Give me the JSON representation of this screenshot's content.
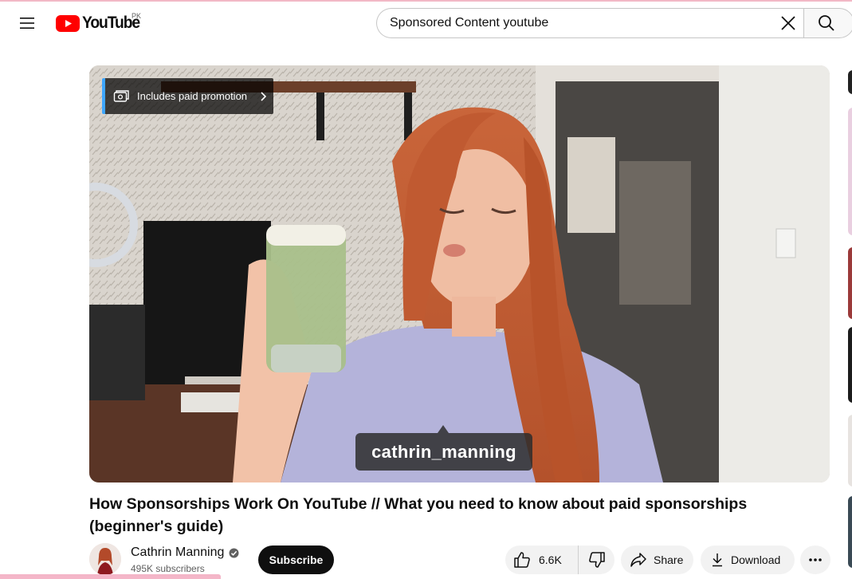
{
  "header": {
    "logo_text": "YouTube",
    "country_code": "PK",
    "search_value": "Sponsored Content youtube",
    "menu_icon": "hamburger-icon",
    "clear_icon": "close-icon",
    "search_icon": "search-icon"
  },
  "player": {
    "promo_label": "Includes paid promotion",
    "name_tag": "cathrin_manning"
  },
  "video": {
    "title": "How Sponsorships Work On YouTube // What you need to know about paid sponsorships (beginner's guide)"
  },
  "channel": {
    "name": "Cathrin Manning",
    "subscribers": "495K subscribers",
    "subscribe_label": "Subscribe"
  },
  "actions": {
    "likes": "6.6K",
    "share_label": "Share",
    "download_label": "Download"
  },
  "colors": {
    "brand_red": "#ff0000",
    "promo_accent": "#3ea6ff"
  }
}
